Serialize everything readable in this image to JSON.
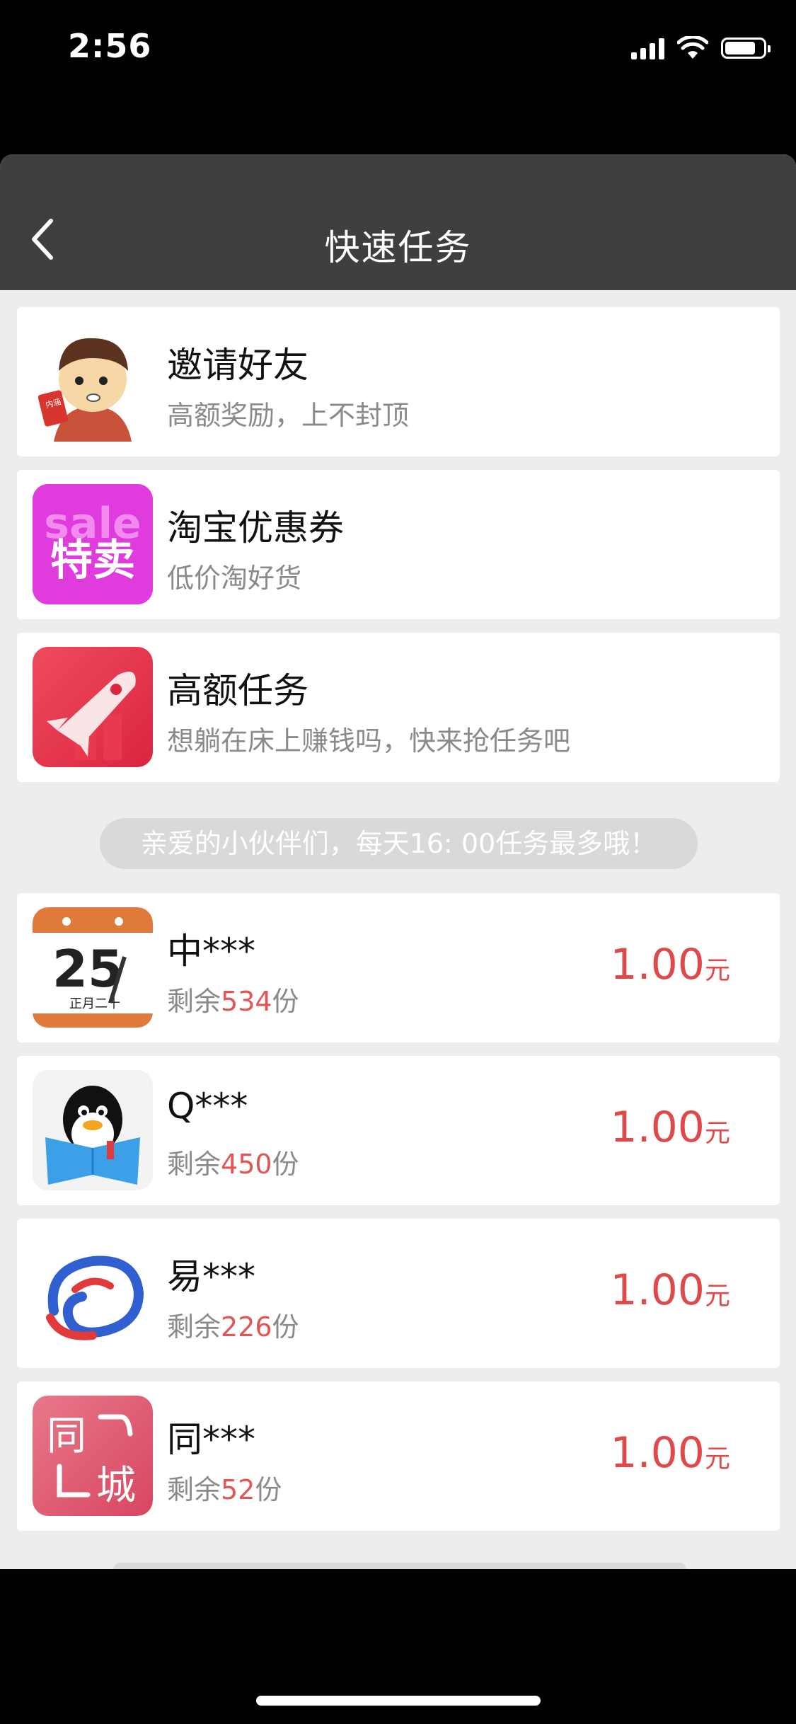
{
  "status_bar": {
    "time": "2:56"
  },
  "nav": {
    "title": "快速任务"
  },
  "featured": [
    {
      "title": "邀请好友",
      "subtitle": "高额奖励，上不封顶",
      "icon": "cartoon-boy-icon"
    },
    {
      "title": "淘宝优惠券",
      "subtitle": "低价淘好货",
      "icon": "sale-tag-icon",
      "icon_text_top": "sale",
      "icon_text_main": "特卖"
    },
    {
      "title": "高额任务",
      "subtitle": "想躺在床上赚钱吗，快来抢任务吧",
      "icon": "rocket-icon"
    }
  ],
  "notice": "亲爱的小伙伴们，每天16: 00任务最多哦！",
  "tasks": [
    {
      "name": "中***",
      "remain_prefix": "剩余",
      "remain": "534",
      "remain_suffix": "份",
      "price": "1.00",
      "unit": "元",
      "icon": "calendar-icon",
      "cal_day": "25",
      "cal_sub": "正月二十"
    },
    {
      "name": "Q***",
      "remain_prefix": "剩余",
      "remain": "450",
      "remain_suffix": "份",
      "price": "1.00",
      "unit": "元",
      "icon": "qq-reader-icon"
    },
    {
      "name": "易***",
      "remain_prefix": "剩余",
      "remain": "226",
      "remain_suffix": "份",
      "price": "1.00",
      "unit": "元",
      "icon": "swirl-logo-icon"
    },
    {
      "name": "同***",
      "remain_prefix": "剩余",
      "remain": "52",
      "remain_suffix": "份",
      "price": "1.00",
      "unit": "元",
      "icon": "tongcheng-icon",
      "logo_a": "同",
      "logo_b": "城"
    }
  ],
  "colors": {
    "accent": "#e0494a",
    "nav_bg": "#3f3f42",
    "page_bg": "#ededed"
  }
}
